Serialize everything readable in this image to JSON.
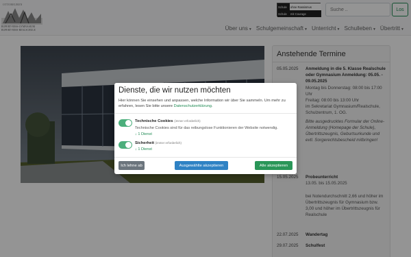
{
  "header": {
    "logo": {
      "top_text": "OTTOBEUREN",
      "line1": "RUPERT-NESS-GYMNASIUM",
      "line2": "RUPERT-NESS-REALSCHULE"
    },
    "badge": {
      "cell1": "Schule",
      "cell2": "ohne Rassismus",
      "cell3": "Schule",
      "cell4": "mit Courage"
    },
    "search": {
      "placeholder": "Suche ..",
      "button_label": "Los"
    },
    "nav": [
      {
        "label": "Über uns"
      },
      {
        "label": "Schulgemeinschaft"
      },
      {
        "label": "Unterricht"
      },
      {
        "label": "Schulleben"
      },
      {
        "label": "Übertritt"
      }
    ],
    "caret": "▼"
  },
  "termine": {
    "title": "Anstehende Termine",
    "events": [
      {
        "date": "05.05.2025",
        "title": "Anmeldung in die 5. Klasse Realschule oder Gymnasium Anmeldung: 05.05. - 09.05.2025",
        "body": "Montag bis Donnerstag: 08:00 bis 17:00 Uhr\nFreitag: 08:00 bis 13:00 Uhr\nim Sekretariat Gymnasium/Realschule, Schulzentrum, 1. OG.",
        "note": "Bitte ausgedrucktes Formular der Online-Anmeldung (Homepage der Schule), Übertrittszeugnis, Geburtsurkunde und evtl. Sorgerechtsbescheid mitbringen!"
      },
      {
        "date": "15.05.2025",
        "title": "Probeunterricht",
        "body": "13.05. bis 15.05.2025\n\nbei Notendurchschnitt 2,66 und höher im Übertrittszeugnis für Gymnasium bzw. 3,00 und höher im Übertrittszeugnis für Realschule",
        "note": ""
      },
      {
        "date": "22.07.2025",
        "title": "Wandertag",
        "body": "",
        "note": ""
      },
      {
        "date": "29.07.2025",
        "title": "Schulfest",
        "body": "",
        "note": ""
      }
    ]
  },
  "consent": {
    "title": "Dienste, die wir nutzen möchten",
    "intro": "Hier können Sie einsehen und anpassen, welche Information wir über Sie sammeln. Um mehr zu erfahren, lesen Sie bitte unsere",
    "privacy_link": "Datenschutzerklärung",
    "services": [
      {
        "name": "Technische Cookies",
        "required": "(immer erforderlich)",
        "desc": "Technische Cookies sind für das reibungslose Funktionieren der Website notwendig.",
        "count": "↓ 1 Dienst",
        "enabled": true
      },
      {
        "name": "Sicherheit",
        "required": "(immer erforderlich)",
        "desc": "",
        "count": "↓ 1 Dienst",
        "enabled": true
      }
    ],
    "buttons": {
      "decline": "Ich lehne ab",
      "accept_selected": "Ausgewählte akzeptieren",
      "accept_all": "Alle akzeptieren"
    },
    "colors": {
      "accept_all": "#2a9658",
      "accept_selected": "#2f82c4",
      "decline": "#6c757d",
      "link": "#1f8a53"
    }
  }
}
